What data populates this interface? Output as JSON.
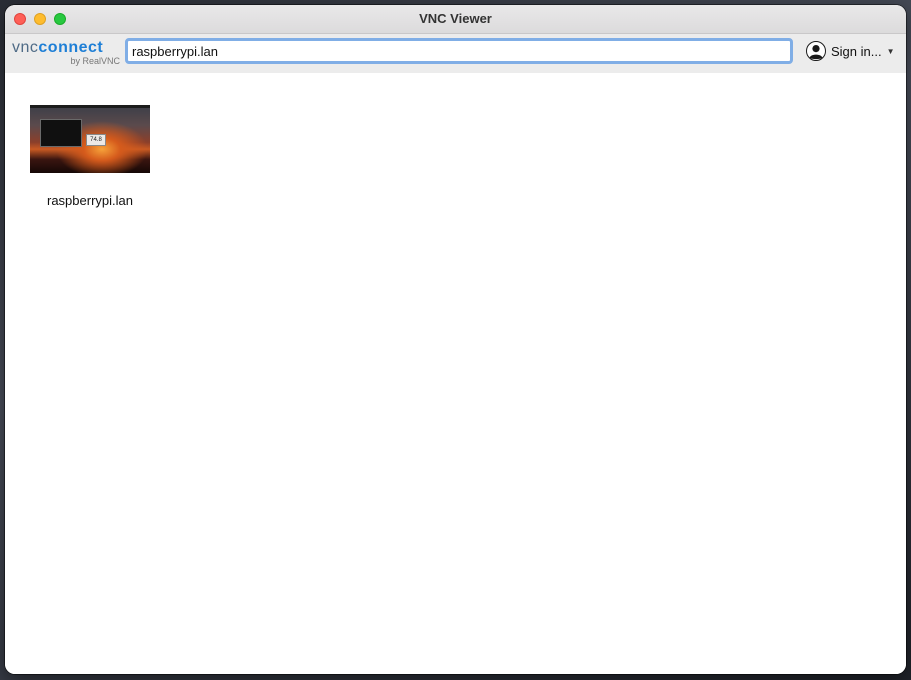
{
  "window": {
    "title": "VNC Viewer"
  },
  "logo": {
    "brand_left": "vnc",
    "brand_right": "connect",
    "byline": "by RealVNC"
  },
  "search": {
    "value": "raspberrypi.lan"
  },
  "account": {
    "sign_in_label": "Sign in...",
    "icon": "person-icon"
  },
  "computers": [
    {
      "name": "raspberrypi.lan",
      "thumbnail_dialog_text": "74.8"
    }
  ],
  "colors": {
    "accent_focus": "#80aee6",
    "brand_blue": "#1e7fd6",
    "brand_gray": "#4f6b86"
  }
}
